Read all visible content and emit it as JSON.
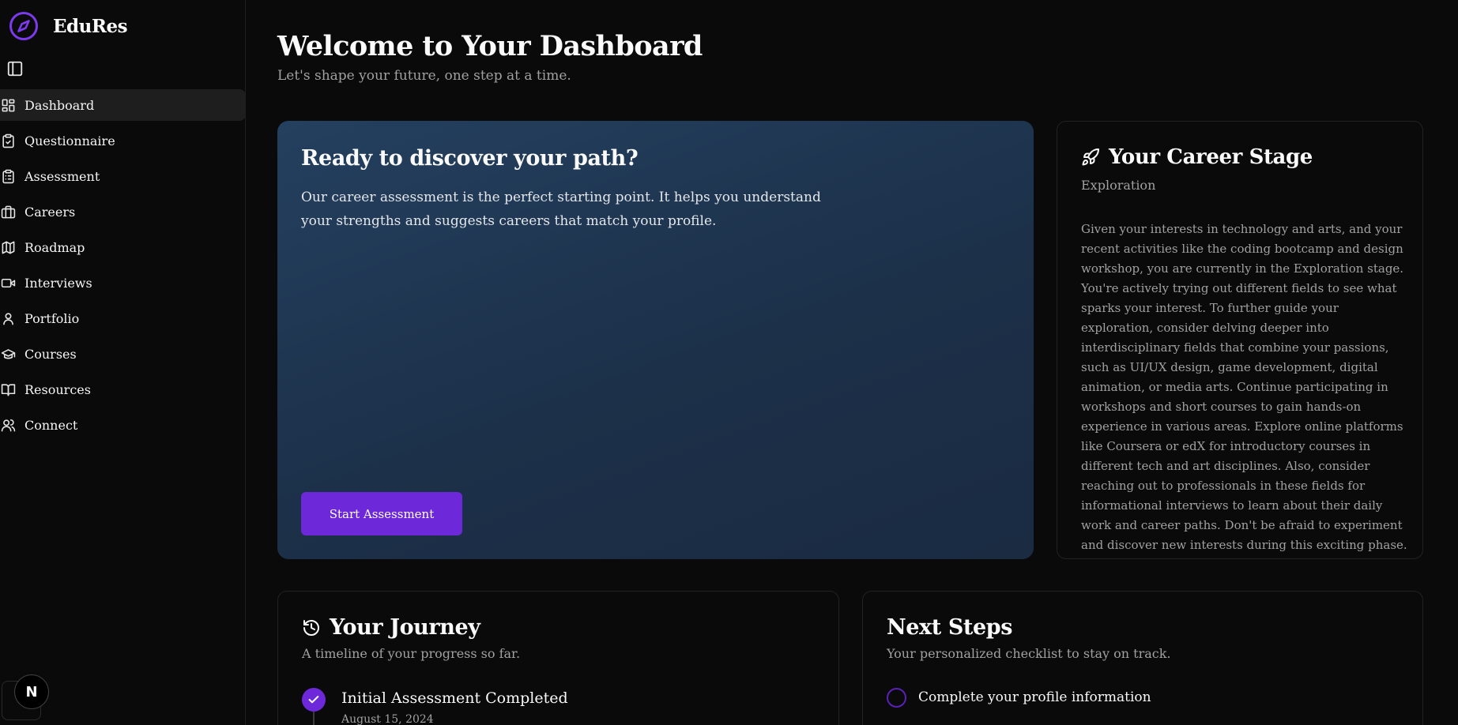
{
  "app": {
    "name": "EduRes"
  },
  "sidebar": {
    "items": [
      {
        "label": "Dashboard",
        "icon": "layout-grid-icon",
        "active": true
      },
      {
        "label": "Questionnaire",
        "icon": "clipboard-check-icon"
      },
      {
        "label": "Assessment",
        "icon": "clipboard-list-icon"
      },
      {
        "label": "Careers",
        "icon": "briefcase-icon"
      },
      {
        "label": "Roadmap",
        "icon": "map-icon"
      },
      {
        "label": "Interviews",
        "icon": "video-icon"
      },
      {
        "label": "Portfolio",
        "icon": "user-icon"
      },
      {
        "label": "Courses",
        "icon": "graduation-cap-icon"
      },
      {
        "label": "Resources",
        "icon": "book-open-icon"
      },
      {
        "label": "Connect",
        "icon": "users-icon"
      }
    ],
    "badge": "N"
  },
  "header": {
    "title": "Welcome to Your Dashboard",
    "subtitle": "Let's shape your future, one step at a time."
  },
  "hero": {
    "title": "Ready to discover your path?",
    "text": "Our career assessment is the perfect starting point. It helps you understand your strengths and suggests careers that match your profile.",
    "button": "Start Assessment"
  },
  "stage": {
    "title": "Your Career Stage",
    "name": "Exploration",
    "body": "Given your interests in technology and arts, and your recent activities like the coding bootcamp and design workshop, you are currently in the Exploration stage. You're actively trying out different fields to see what sparks your interest. To further guide your exploration, consider delving deeper into interdisciplinary fields that combine your passions, such as UI/UX design, game development, digital animation, or media arts. Continue participating in workshops and short courses to gain hands-on experience in various areas. Explore online platforms like Coursera or edX for introductory courses in different tech and art disciplines. Also, consider reaching out to professionals in these fields for informational interviews to learn about their daily work and career paths. Don't be afraid to experiment and discover new interests during this exciting phase."
  },
  "journey": {
    "title": "Your Journey",
    "subtitle": "A timeline of your progress so far.",
    "items": [
      {
        "title": "Initial Assessment Completed",
        "date": "August 15, 2024"
      }
    ]
  },
  "next_steps": {
    "title": "Next Steps",
    "subtitle": "Your personalized checklist to stay on track.",
    "items": [
      {
        "label": "Complete your profile information"
      }
    ]
  },
  "colors": {
    "accent": "#6d28d9",
    "hero_bg": "#1e3450",
    "background": "#0a0a0a"
  }
}
